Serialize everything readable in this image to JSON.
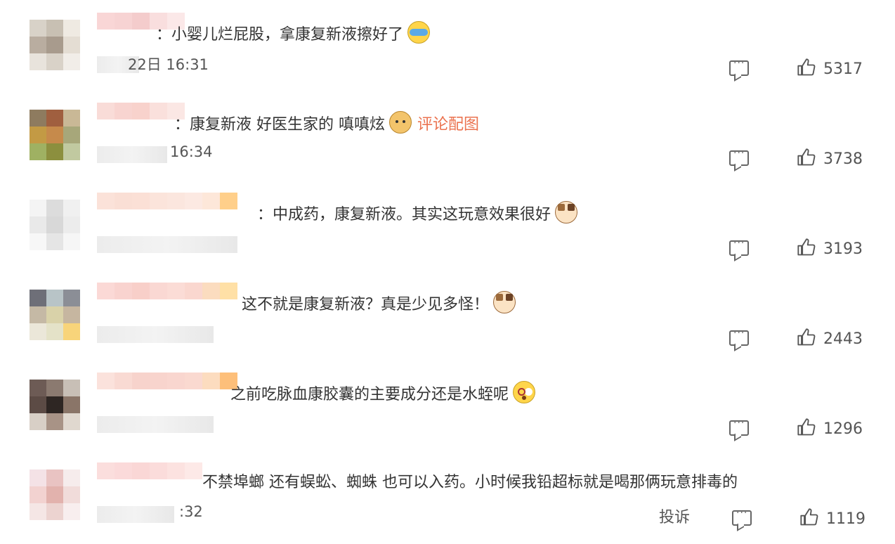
{
  "comments": [
    {
      "text": "：小婴儿烂屁股，拿康复新液擦好了",
      "emoji": "cry-emoji-icon",
      "time": "22日 16:31",
      "likes": "5317",
      "avatar_colors": [
        "#d8d2c8",
        "#c8c0b3",
        "#efeae2",
        "#b9ada0",
        "#a89b8d",
        "#e4ddd3",
        "#e8e3dc",
        "#d9d2c8",
        "#f1ede8"
      ],
      "name_colors": [
        "#f9d6d6",
        "#f7d3d3",
        "#f4cccc",
        "#f9dede",
        "#fbe8e8",
        "#ffffff",
        "#ffffff",
        "#ffffff"
      ]
    },
    {
      "text": "：康复新液 好医生家的 嗔嗔炫",
      "emoji": "doge-emoji-icon",
      "extra_link": "评论配图",
      "time": "16:34",
      "likes": "3738",
      "avatar_colors": [
        "#8e7b5f",
        "#a05f3f",
        "#c9b896",
        "#c39a44",
        "#c68a4b",
        "#a7a77a",
        "#9fb162",
        "#8c8f3e",
        "#c1c9a0"
      ],
      "name_colors": [
        "#f9dcd8",
        "#f8d4d0",
        "#f8d2cc",
        "#fae0dc",
        "#fbe7e4",
        "#ffffff",
        "#ffffff",
        "#ffffff"
      ]
    },
    {
      "text": "：中成药，康复新液。其实这玩意效果很好",
      "emoji": "cat-emoji-icon",
      "time": "",
      "likes": "3193",
      "avatar_colors": [
        "#f4f4f4",
        "#dcdcdc",
        "#f0f0f0",
        "#e9e9e9",
        "#d8d8d8",
        "#ececec",
        "#f7f7f7",
        "#e5e5e5",
        "#f6f6f6"
      ],
      "name_colors": [
        "#fbe2d9",
        "#fadfd5",
        "#fbe0d6",
        "#fbe4db",
        "#fbe6de",
        "#fce9e2",
        "#fde7d9",
        "#ffcf8a"
      ]
    },
    {
      "text": "这不就是康复新液？真是少见多怪！",
      "emoji": "cat-emoji-icon",
      "time": "",
      "likes": "2443",
      "avatar_colors": [
        "#6e6f78",
        "#b8c4c7",
        "#8b8e96",
        "#c5b9a5",
        "#d9d2a9",
        "#c6b6a0",
        "#ebe7d9",
        "#e4e2c8",
        "#f8d47a"
      ],
      "name_colors": [
        "#fbd9d6",
        "#f9d3cf",
        "#f8cfc9",
        "#fad8d3",
        "#fbdcd6",
        "#fad7cf",
        "#fbdcbf",
        "#ffe0a6"
      ]
    },
    {
      "text": "之前吃脉血康胶囊的主要成分还是水蛭呢",
      "emoji": "shock-emoji-icon",
      "time": "",
      "likes": "1296",
      "avatar_colors": [
        "#6d5b55",
        "#8b7a70",
        "#c8bfb6",
        "#5c4b45",
        "#2e2623",
        "#8a7568",
        "#d8cfc6",
        "#a89386",
        "#e0d8cf"
      ],
      "name_colors": [
        "#fbe2dc",
        "#f9dad3",
        "#f7d3cc",
        "#f8d4cd",
        "#f9d6cf",
        "#fad9d0",
        "#fcdcbf",
        "#fdbf7a"
      ]
    },
    {
      "text": "不禁埠螂 还有蜈蚣、蜘蛛 也可以入药。小时候我铅超标就是喝那俩玩意排毒的",
      "emoji": "",
      "time": ":32",
      "likes": "1119",
      "avatar_colors": [
        "#f4e2e6",
        "#e9c3c2",
        "#f6ecec",
        "#f2d2d0",
        "#e2b2ad",
        "#f1dcda",
        "#f5e6e5",
        "#ecd3d0",
        "#f8eeee"
      ],
      "name_colors": [
        "#fbdedd",
        "#fbdada",
        "#fad7d6",
        "#fbdcdb",
        "#fce2e0",
        "#fde9e7",
        "#ffffff",
        "#ffffff"
      ]
    }
  ],
  "report_label": "投诉"
}
